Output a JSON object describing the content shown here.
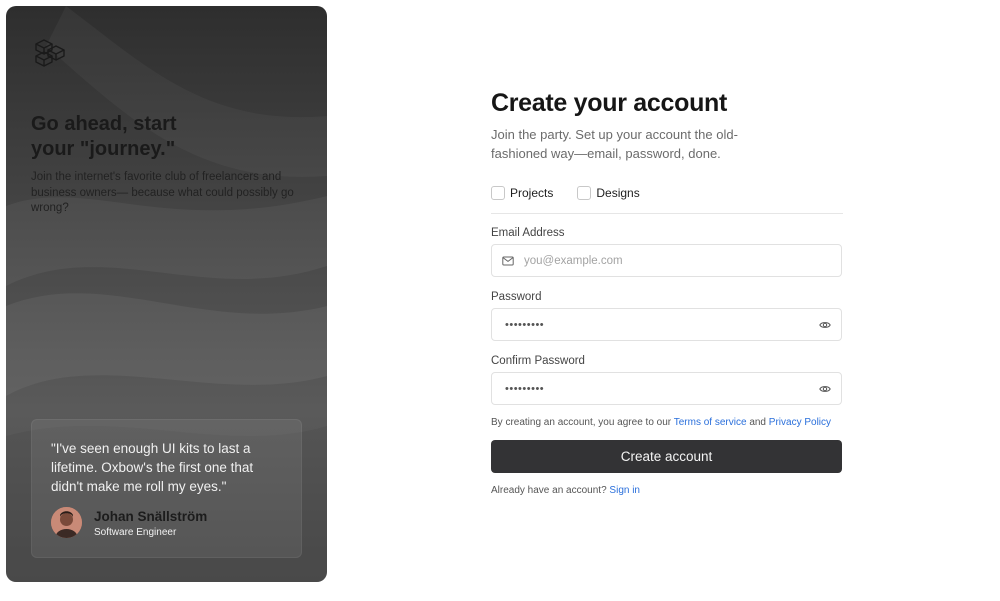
{
  "hero": {
    "logo_icon": "layered-cubes-logo-icon",
    "title_line1": "Go ahead, start",
    "title_line2": "your \"journey.\"",
    "subtitle": "Join the internet's favorite club of freelancers and business owners— because what could possibly go wrong?",
    "quote": "\"I've seen enough UI kits to last a lifetime. Oxbow's the first one that didn't make me roll my eyes.\"",
    "person_name": "Johan Snällström",
    "person_role": "Software Engineer",
    "avatar_icon": "avatar-portrait"
  },
  "form": {
    "title": "Create your account",
    "subtitle": "Join the party. Set up your account the old-fashioned way—email, password, done.",
    "checkboxes": [
      {
        "label": "Projects",
        "checked": false
      },
      {
        "label": "Designs",
        "checked": false
      }
    ],
    "email": {
      "label": "Email Address",
      "placeholder": "you@example.com",
      "icon": "mail-icon"
    },
    "password": {
      "label": "Password",
      "value": "•••••••••",
      "icon": "eye-icon"
    },
    "confirm_password": {
      "label": "Confirm Password",
      "value": "•••••••••",
      "icon": "eye-icon"
    },
    "terms_prefix": "By creating an account, you agree to our",
    "terms_link": "Terms of service",
    "terms_and": "and",
    "privacy_link": "Privacy Policy",
    "submit_label": "Create account",
    "signin_prefix": "Already have an account?",
    "signin_link": "Sign in"
  },
  "colors": {
    "accent_link": "#2a6fdb",
    "button_bg": "#333335",
    "hero_dark": "#2e2e2e"
  }
}
